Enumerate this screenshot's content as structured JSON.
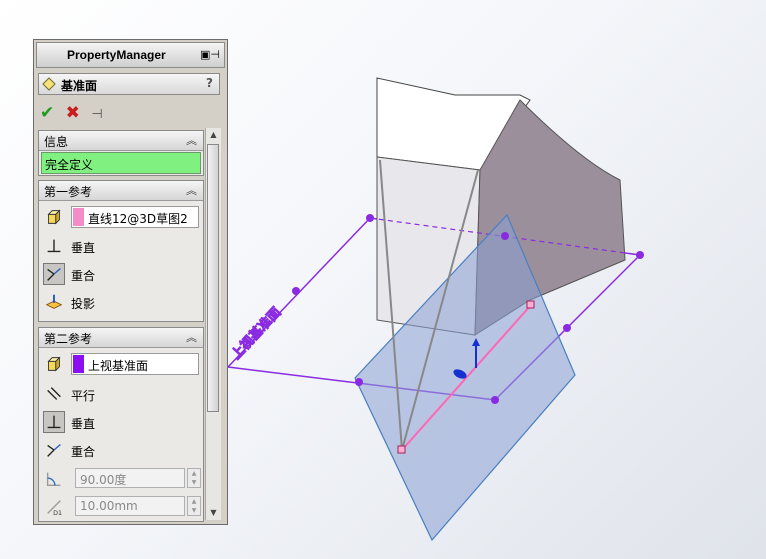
{
  "property_manager": {
    "title": "PropertyManager",
    "feature_name": "基准面",
    "help_label": "?",
    "sections": {
      "info": {
        "title": "信息",
        "status": "完全定义"
      },
      "first_ref": {
        "title": "第一参考",
        "selection": "直线12@3D草图2",
        "swatch_color": "#f58bc8",
        "options": [
          "垂直",
          "重合",
          "投影"
        ]
      },
      "second_ref": {
        "title": "第二参考",
        "selection": "上视基准面",
        "swatch_color": "#8b0ff0",
        "options": [
          "平行",
          "垂直",
          "重合"
        ],
        "angle_value": "90.00度",
        "distance_value": "10.00mm"
      }
    }
  },
  "viewport": {
    "plane_label": "上视基准面",
    "colors": {
      "plane_outline": "#8a2be2",
      "new_plane_fill": "#8aa0d4",
      "edge_pink": "#ff66b4"
    }
  }
}
